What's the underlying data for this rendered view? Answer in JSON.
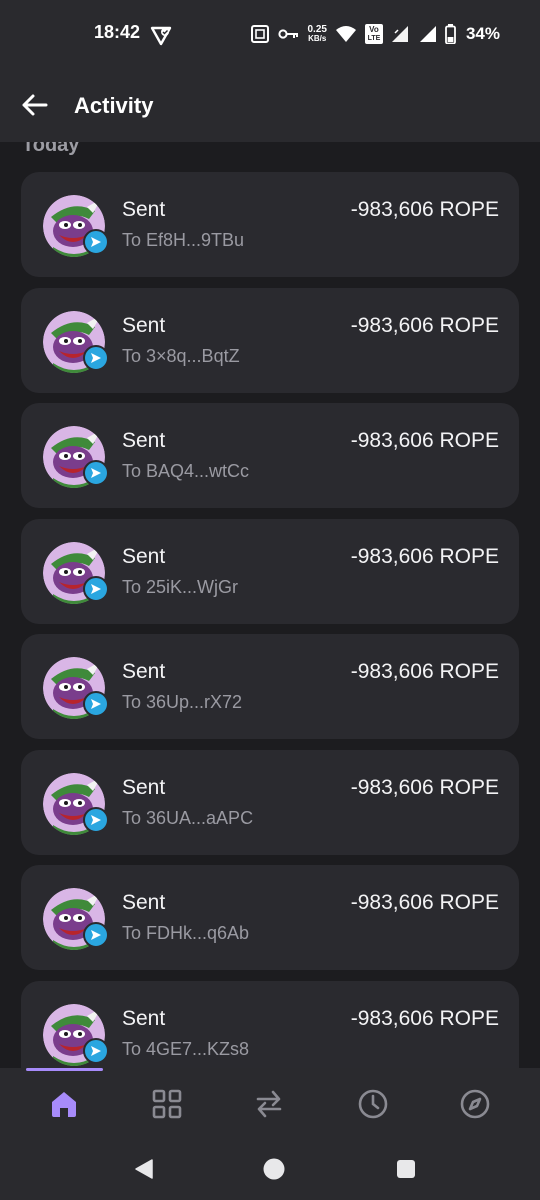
{
  "status_bar": {
    "time": "18:42",
    "net_speed_value": "0.25",
    "net_speed_unit": "KB/s",
    "volte_top": "Vo",
    "volte_bottom": "LTE",
    "battery": "34%"
  },
  "header": {
    "title": "Activity",
    "back_icon": "arrow-left-icon"
  },
  "activity": {
    "section_label": "Today",
    "transactions": [
      {
        "type": "Sent",
        "to": "To Ef8H...9TBu",
        "amount": "-983,606 ROPE"
      },
      {
        "type": "Sent",
        "to": "To 3×8q...BqtZ",
        "amount": "-983,606 ROPE"
      },
      {
        "type": "Sent",
        "to": "To BAQ4...wtCc",
        "amount": "-983,606 ROPE"
      },
      {
        "type": "Sent",
        "to": "To 25iK...WjGr",
        "amount": "-983,606 ROPE"
      },
      {
        "type": "Sent",
        "to": "To 36Up...rX72",
        "amount": "-983,606 ROPE"
      },
      {
        "type": "Sent",
        "to": "To 36UA...aAPC",
        "amount": "-983,606 ROPE"
      },
      {
        "type": "Sent",
        "to": "To FDHk...q6Ab",
        "amount": "-983,606 ROPE"
      },
      {
        "type": "Sent",
        "to": "To 4GE7...KZs8",
        "amount": "-983,606 ROPE"
      }
    ]
  },
  "tab_bar": {
    "active": "home",
    "icons": [
      "home-icon",
      "grid-icon",
      "swap-icon",
      "history-icon",
      "compass-icon"
    ],
    "accent_color": "#a78bfa",
    "inactive_color": "#8a8a92"
  },
  "colors": {
    "background": "#1c1c1f",
    "card": "#2a2a2f",
    "badge": "#2aa6e0"
  }
}
